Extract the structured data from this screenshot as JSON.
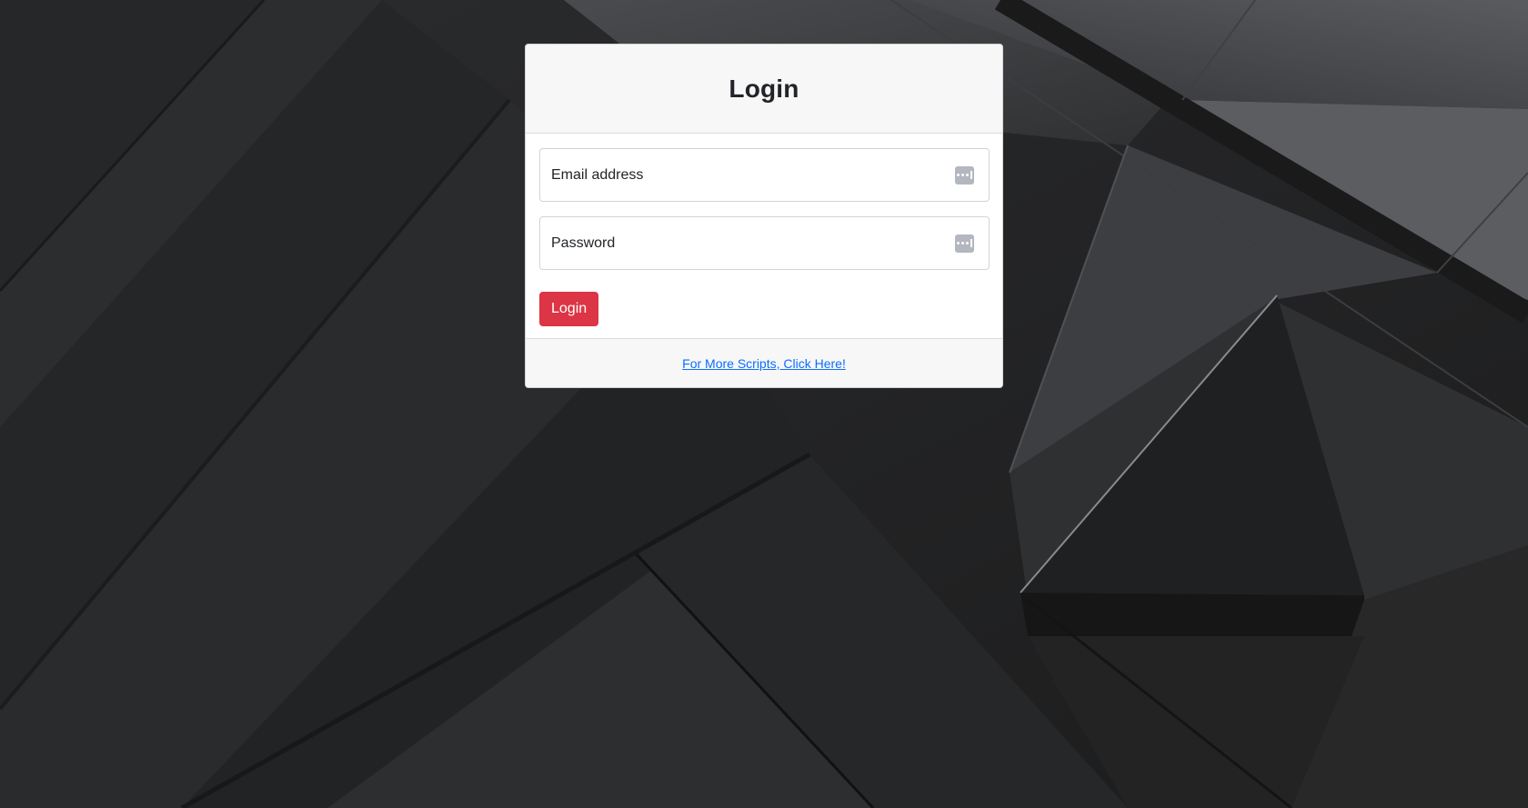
{
  "login": {
    "title": "Login",
    "email": {
      "placeholder": "Email address",
      "value": ""
    },
    "password": {
      "placeholder": "Password",
      "value": ""
    },
    "submit_label": "Login",
    "footer_link_text": "For More Scripts, Click Here!"
  },
  "icons": {
    "field_autofill": "password-manager-icon"
  },
  "colors": {
    "primary_button": "#dc3545",
    "link": "#0d6efd",
    "background": "#232323"
  }
}
